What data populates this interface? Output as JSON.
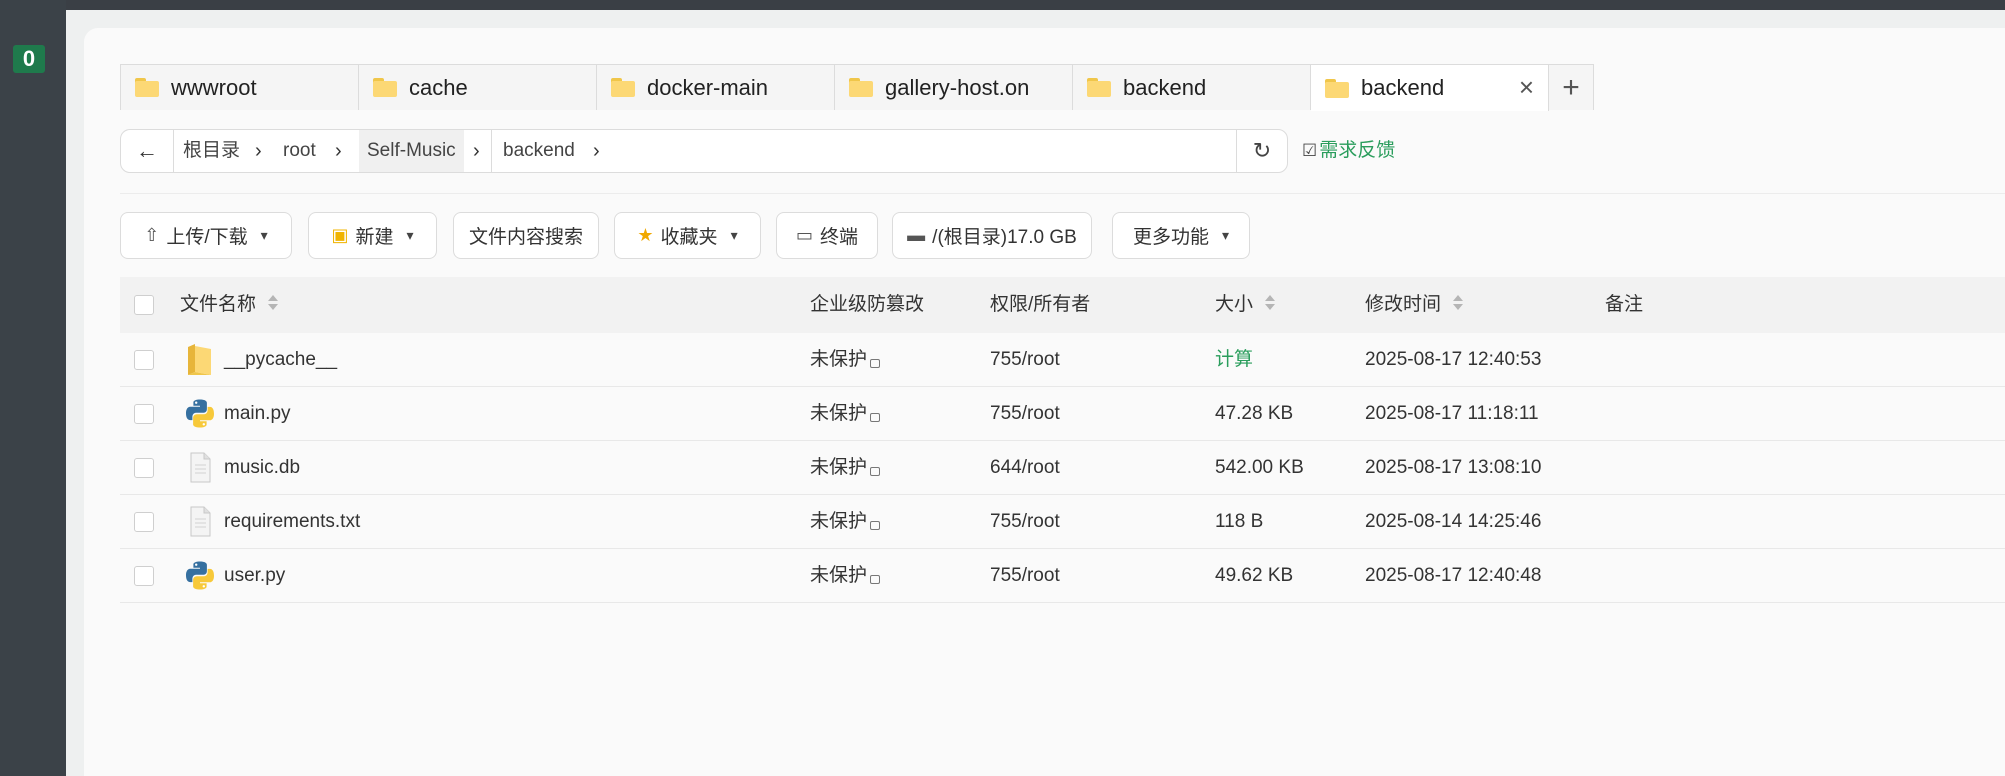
{
  "sidebar": {
    "badge": "0"
  },
  "tabs": [
    {
      "label": "wwwroot"
    },
    {
      "label": "cache"
    },
    {
      "label": "docker-main"
    },
    {
      "label": "gallery-host.on"
    },
    {
      "label": "backend"
    },
    {
      "label": "backend",
      "active": true
    }
  ],
  "tab_add": "+",
  "tab_close": "×",
  "path": {
    "back": "←",
    "crumbs": [
      "根目录",
      "root",
      "Self-Music",
      "backend"
    ],
    "sep": "›",
    "refresh": "↻"
  },
  "feedback": {
    "icon": "☑",
    "label": "需求反馈"
  },
  "toolbar": {
    "upload": "上传/下载",
    "new": "新建",
    "search": "文件内容搜索",
    "favorites": "收藏夹",
    "terminal": "终端",
    "disk": "/(根目录)17.0 GB",
    "more": "更多功能",
    "caret": "▾"
  },
  "columns": {
    "name": "文件名称",
    "protect": "企业级防篡改",
    "perm": "权限/所有者",
    "size": "大小",
    "mtime": "修改时间",
    "note": "备注"
  },
  "files": [
    {
      "name": "__pycache__",
      "type": "folder",
      "protect": "未保护",
      "perm": "755/root",
      "size": "计算",
      "mtime": "2025-08-17 12:40:53"
    },
    {
      "name": "main.py",
      "type": "python",
      "protect": "未保护",
      "perm": "755/root",
      "size": "47.28 KB",
      "mtime": "2025-08-17 11:18:11"
    },
    {
      "name": "music.db",
      "type": "file",
      "protect": "未保护",
      "perm": "644/root",
      "size": "542.00 KB",
      "mtime": "2025-08-17 13:08:10"
    },
    {
      "name": "requirements.txt",
      "type": "file",
      "protect": "未保护",
      "perm": "755/root",
      "size": "118 B",
      "mtime": "2025-08-14 14:25:46"
    },
    {
      "name": "user.py",
      "type": "python",
      "protect": "未保护",
      "perm": "755/root",
      "size": "49.62 KB",
      "mtime": "2025-08-17 12:40:48"
    }
  ],
  "colors": {
    "accent_green": "#2a9d5c",
    "folder_yellow": "#fcd875",
    "badge_green": "#1f7a4c"
  }
}
